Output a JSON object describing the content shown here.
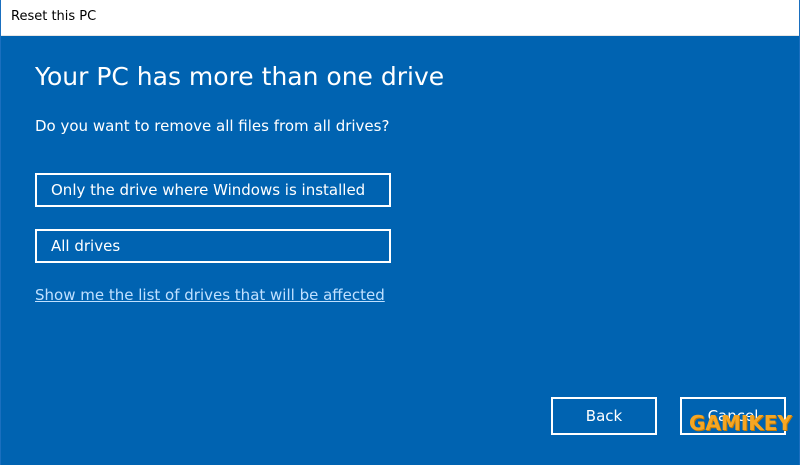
{
  "window": {
    "title": "Reset this PC"
  },
  "main": {
    "heading": "Your PC has more than one drive",
    "question": "Do you want to remove all files from all drives?",
    "options": [
      "Only the drive where Windows is installed",
      "All drives"
    ],
    "link": "Show me the list of drives that will be affected"
  },
  "footer": {
    "back_label": "Back",
    "cancel_label": "Cancel"
  },
  "watermark": {
    "text": "GAMIKEY"
  },
  "colors": {
    "background": "#0063b1",
    "text": "#ffffff",
    "link": "#bfe0ff",
    "watermark": "#f5a623"
  }
}
